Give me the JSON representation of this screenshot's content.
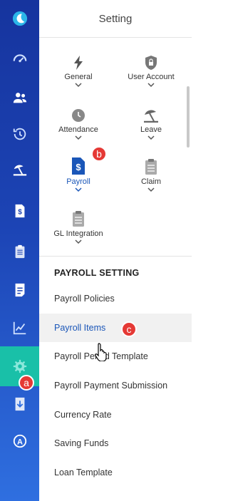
{
  "panel": {
    "title": "Setting"
  },
  "rail": {
    "items": [
      {
        "icon": "moon-logo-icon"
      },
      {
        "icon": "dashboard-icon"
      },
      {
        "icon": "people-icon"
      },
      {
        "icon": "history-clock-icon"
      },
      {
        "icon": "leave-beach-icon"
      },
      {
        "icon": "dollar-document-icon"
      },
      {
        "icon": "clipboard-icon"
      },
      {
        "icon": "document-icon"
      },
      {
        "icon": "line-chart-icon"
      },
      {
        "icon": "settings-gear-icon",
        "active": true
      },
      {
        "icon": "download-icon"
      },
      {
        "icon": "lock-a-icon"
      }
    ],
    "active_color": "#19c0a8"
  },
  "modules": [
    {
      "label": "General",
      "icon": "lightning-icon"
    },
    {
      "label": "User Account",
      "icon": "lock-icon"
    },
    {
      "label": "Attendance",
      "icon": "clock-icon"
    },
    {
      "label": "Leave",
      "icon": "beach-umbrella-icon"
    },
    {
      "label": "Payroll",
      "icon": "dollar-document-icon",
      "active": true
    },
    {
      "label": "Claim",
      "icon": "clipboard-icon"
    },
    {
      "label": "GL Integration",
      "icon": "clipboard-list-icon"
    }
  ],
  "settings": {
    "title": "PAYROLL SETTING",
    "items": [
      "Payroll Policies",
      "Payroll Items",
      "Payroll Period Template",
      "Payroll Payment Submission",
      "Currency Rate",
      "Saving Funds",
      "Loan Template"
    ],
    "selected": "Payroll Items"
  },
  "badges": {
    "a": "a",
    "b": "b",
    "c": "c"
  },
  "accent_color": "#1a56b8",
  "badge_color": "#e53935"
}
